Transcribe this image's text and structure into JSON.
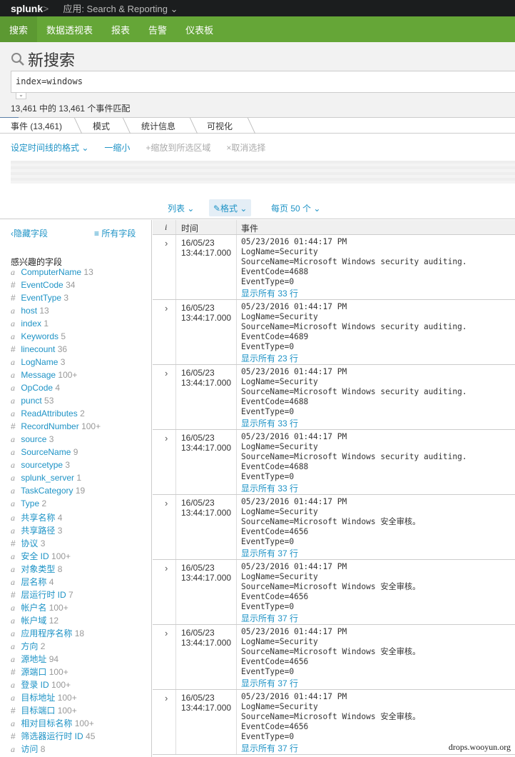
{
  "topbar": {
    "logo": "splunk",
    "logo_suffix": ">",
    "app": "应用: Search & Reporting ⌄"
  },
  "nav": [
    "搜索",
    "数据透视表",
    "报表",
    "告警",
    "仪表板"
  ],
  "header": {
    "title": "新搜索",
    "query": "index=windows",
    "count": "13,461 中的 13,461 个事件匹配"
  },
  "tabs": [
    "事件 (13,461)",
    "模式",
    "统计信息",
    "可视化"
  ],
  "timeline": {
    "format": "设定时间线的格式 ⌄",
    "zoom_out": "一缩小",
    "zoom_sel": "+缩放到所选区域",
    "deselect": "×取消选择"
  },
  "controls": {
    "list": "列表 ⌄",
    "format": "✎格式 ⌄",
    "per_page": "每页 50 个 ⌄"
  },
  "sidebar": {
    "hide": "‹隐藏字段",
    "all": "≡ 所有字段",
    "section": "感兴趣的字段",
    "fields": [
      [
        "a",
        "ComputerName",
        "13"
      ],
      [
        "#",
        "EventCode",
        "34"
      ],
      [
        "#",
        "EventType",
        "3"
      ],
      [
        "a",
        "host",
        "13"
      ],
      [
        "a",
        "index",
        "1"
      ],
      [
        "a",
        "Keywords",
        "5"
      ],
      [
        "#",
        "linecount",
        "36"
      ],
      [
        "a",
        "LogName",
        "3"
      ],
      [
        "a",
        "Message",
        "100+"
      ],
      [
        "a",
        "OpCode",
        "4"
      ],
      [
        "a",
        "punct",
        "53"
      ],
      [
        "a",
        "ReadAttributes",
        "2"
      ],
      [
        "#",
        "RecordNumber",
        "100+"
      ],
      [
        "a",
        "source",
        "3"
      ],
      [
        "a",
        "SourceName",
        "9"
      ],
      [
        "a",
        "sourcetype",
        "3"
      ],
      [
        "a",
        "splunk_server",
        "1"
      ],
      [
        "a",
        "TaskCategory",
        "19"
      ],
      [
        "a",
        "Type",
        "2"
      ],
      [
        "a",
        "共享名称",
        "4"
      ],
      [
        "a",
        "共享路径",
        "3"
      ],
      [
        "#",
        "协议",
        "3"
      ],
      [
        "a",
        "安全 ID",
        "100+"
      ],
      [
        "a",
        "对象类型",
        "8"
      ],
      [
        "a",
        "层名称",
        "4"
      ],
      [
        "#",
        "层运行时 ID",
        "7"
      ],
      [
        "a",
        "帐户名",
        "100+"
      ],
      [
        "a",
        "帐户域",
        "12"
      ],
      [
        "a",
        "应用程序名称",
        "18"
      ],
      [
        "a",
        "方向",
        "2"
      ],
      [
        "a",
        "源地址",
        "94"
      ],
      [
        "#",
        "源端口",
        "100+"
      ],
      [
        "a",
        "登录 ID",
        "100+"
      ],
      [
        "a",
        "目标地址",
        "100+"
      ],
      [
        "#",
        "目标端口",
        "100+"
      ],
      [
        "a",
        "相对目标名称",
        "100+"
      ],
      [
        "#",
        "筛选器运行时 ID",
        "45"
      ],
      [
        "a",
        "访问",
        "8"
      ]
    ]
  },
  "table": {
    "headers": [
      "i",
      "时间",
      "事件"
    ],
    "events": [
      {
        "date": "16/05/23",
        "time": "13:44:17.000",
        "lines": "05/23/2016 01:44:17 PM\nLogName=Security\nSourceName=Microsoft Windows security auditing.\nEventCode=4688\nEventType=0",
        "more": "显示所有 33 行"
      },
      {
        "date": "16/05/23",
        "time": "13:44:17.000",
        "lines": "05/23/2016 01:44:17 PM\nLogName=Security\nSourceName=Microsoft Windows security auditing.\nEventCode=4689\nEventType=0",
        "more": "显示所有 23 行"
      },
      {
        "date": "16/05/23",
        "time": "13:44:17.000",
        "lines": "05/23/2016 01:44:17 PM\nLogName=Security\nSourceName=Microsoft Windows security auditing.\nEventCode=4688\nEventType=0",
        "more": "显示所有 33 行"
      },
      {
        "date": "16/05/23",
        "time": "13:44:17.000",
        "lines": "05/23/2016 01:44:17 PM\nLogName=Security\nSourceName=Microsoft Windows security auditing.\nEventCode=4688\nEventType=0",
        "more": "显示所有 33 行"
      },
      {
        "date": "16/05/23",
        "time": "13:44:17.000",
        "lines": "05/23/2016 01:44:17 PM\nLogName=Security\nSourceName=Microsoft Windows 安全审核。\nEventCode=4656\nEventType=0",
        "more": "显示所有 37 行"
      },
      {
        "date": "16/05/23",
        "time": "13:44:17.000",
        "lines": "05/23/2016 01:44:17 PM\nLogName=Security\nSourceName=Microsoft Windows 安全审核。\nEventCode=4656\nEventType=0",
        "more": "显示所有 37 行"
      },
      {
        "date": "16/05/23",
        "time": "13:44:17.000",
        "lines": "05/23/2016 01:44:17 PM\nLogName=Security\nSourceName=Microsoft Windows 安全审核。\nEventCode=4656\nEventType=0",
        "more": "显示所有 37 行"
      },
      {
        "date": "16/05/23",
        "time": "13:44:17.000",
        "lines": "05/23/2016 01:44:17 PM\nLogName=Security\nSourceName=Microsoft Windows 安全审核。\nEventCode=4656\nEventType=0",
        "more": "显示所有 37 行"
      }
    ]
  },
  "watermark": "drops.wooyun.org",
  "colors": {
    "nav": "#65a637",
    "link": "#1e93c6",
    "topbar": "#1b1d1e"
  }
}
